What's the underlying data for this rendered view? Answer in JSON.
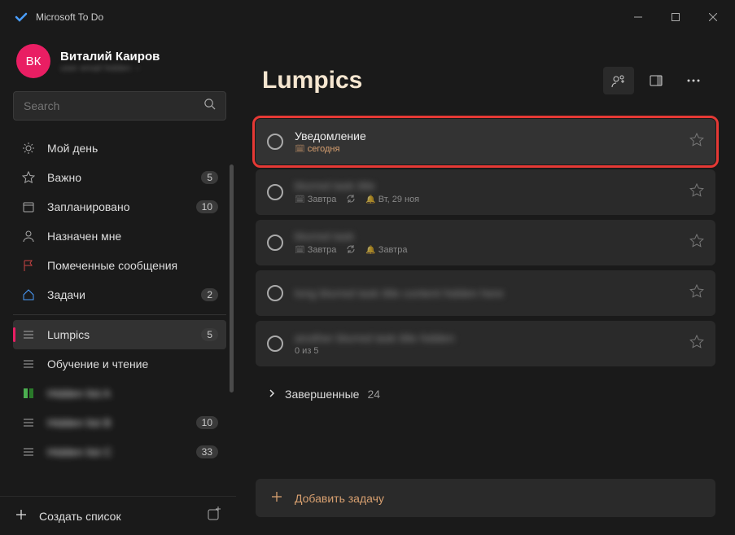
{
  "app": {
    "title": "Microsoft To Do"
  },
  "profile": {
    "initials": "ВК",
    "name": "Виталий Каиров",
    "email_blurred": "user email hidden"
  },
  "search": {
    "placeholder": "Search"
  },
  "nav": {
    "my_day": "Мой день",
    "important": {
      "label": "Важно",
      "count": "5"
    },
    "planned": {
      "label": "Запланировано",
      "count": "10"
    },
    "assigned": "Назначен мне",
    "flagged": "Помеченные сообщения",
    "tasks": {
      "label": "Задачи",
      "count": "2"
    }
  },
  "lists": [
    {
      "label": "Lumpics",
      "count": "5",
      "selected": true
    },
    {
      "label": "Обучение и чтение"
    },
    {
      "label": "Hidden list A",
      "blurred": true
    },
    {
      "label": "Hidden list B",
      "count": "10",
      "blurred": true
    },
    {
      "label": "Hidden list C",
      "count": "33",
      "blurred": true
    }
  ],
  "sidebar_bottom": {
    "new_list": "Создать список"
  },
  "main": {
    "title": "Lumpics",
    "tasks": [
      {
        "title": "Уведомление",
        "meta_date": "сегодня",
        "highlighted": true
      },
      {
        "title": "blurred task title",
        "blurred": true,
        "meta_date": "Завтра",
        "meta_repeat": true,
        "meta_bell": "Вт, 29 ноя"
      },
      {
        "title": "blurred task",
        "blurred": true,
        "meta_date": "Завтра",
        "meta_repeat": true,
        "meta_bell": "Завтра"
      },
      {
        "title": "long blurred task title content hidden here",
        "blurred": true
      },
      {
        "title": "another blurred task title hidden",
        "blurred": true,
        "meta_sub": "0 из 5"
      }
    ],
    "completed": {
      "label": "Завершенные",
      "count": "24"
    },
    "add_task": "Добавить задачу"
  }
}
